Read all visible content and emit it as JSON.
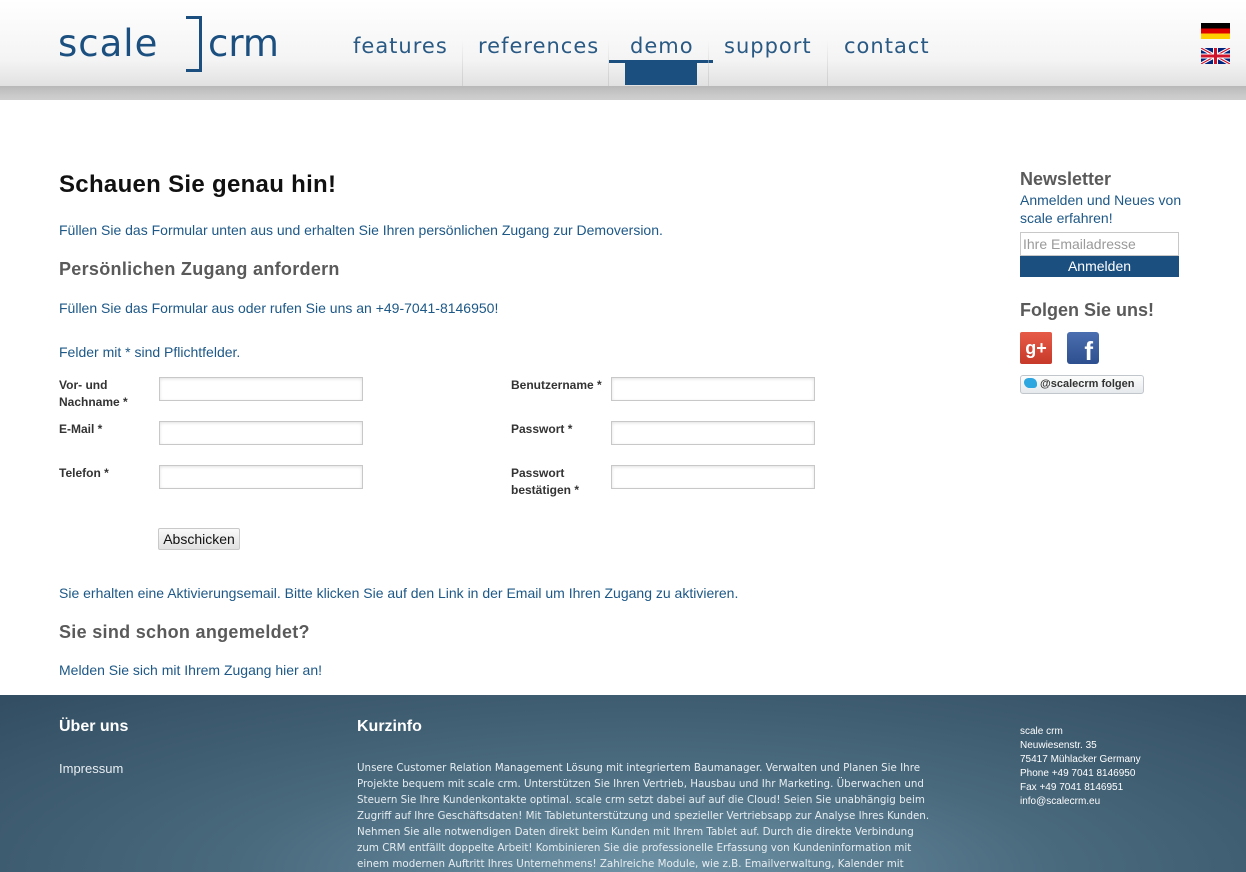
{
  "header": {
    "logo_left": "scale",
    "logo_right": "crm",
    "nav": [
      {
        "label": "features"
      },
      {
        "label": "references"
      },
      {
        "label": "demo",
        "active": true
      },
      {
        "label": "support"
      },
      {
        "label": "contact"
      }
    ],
    "flags": [
      "german-flag-icon",
      "uk-flag-icon"
    ]
  },
  "main": {
    "title": "Schauen Sie genau hin!",
    "intro": "Füllen Sie das Formular unten aus und erhalten Sie Ihren persönlichen Zugang zur Demoversion.",
    "section_title": "Persönlichen Zugang anfordern",
    "call_text": "Füllen Sie das Formular aus oder rufen Sie uns an +49-7041-8146950!",
    "required_note": "Felder mit * sind Pflichtfelder.",
    "form": {
      "name_label_1": "Vor- und",
      "name_label_2": "Nachname *",
      "email_label": "E-Mail *",
      "phone_label": "Telefon *",
      "username_label": "Benutzername *",
      "password_label": "Passwort *",
      "confirm_label_1": "Passwort",
      "confirm_label_2": "bestätigen *",
      "submit_label": "Abschicken"
    },
    "activation_text": "Sie erhalten eine Aktivierungsemail. Bitte klicken Sie auf den Link in der Email um Ihren Zugang zu aktivieren.",
    "login_title": "Sie sind schon angemeldet?",
    "login_text": "Melden Sie sich mit Ihrem Zugang hier an!"
  },
  "sidebar": {
    "newsletter_title": "Newsletter",
    "newsletter_text": "Anmelden und Neues von scale erfahren!",
    "email_placeholder": "Ihre Emailadresse",
    "subscribe_label": "Anmelden",
    "follow_title": "Folgen Sie uns!",
    "gplus_glyph": "g+",
    "facebook_glyph": "f",
    "twitter_label": "@scalecrm folgen"
  },
  "footer": {
    "about_title": "Über uns",
    "impressum": "Impressum",
    "info_title": "Kurzinfo",
    "info_text": "Unsere Customer Relation Management Lösung mit integriertem Baumanager. Verwalten und Planen Sie Ihre Projekte bequem mit scale crm. Unterstützen Sie Ihren Vertrieb, Hausbau und Ihr Marketing. Überwachen und Steuern Sie Ihre Kundenkontakte optimal. scale crm setzt dabei auf auf die Cloud! Seien Sie unabhängig beim Zugriff auf Ihre Geschäftsdaten! Mit Tabletunterstützung und spezieller Vertriebsapp zur Analyse Ihres Kunden. Nehmen Sie alle notwendigen Daten direkt beim Kunden mit Ihrem Tablet auf. Durch die direkte Verbindung zum CRM entfällt doppelte Arbeit! Kombinieren Sie die professionelle Erfassung von Kundeninformation mit einem modernen Auftritt Ihres Unternehmens! Zahlreiche Module, wie z.B. Emailverwaltung, Kalender mit Teamfunktion und Einladungsverwaltung,",
    "address": {
      "company": "scale crm",
      "street": "Neuwiesenstr. 35",
      "city": "75417 Mühlacker Germany",
      "phone": "Phone +49 7041 8146950",
      "fax": "Fax +49 7041 8146951",
      "email": "info@scalecrm.eu"
    }
  }
}
